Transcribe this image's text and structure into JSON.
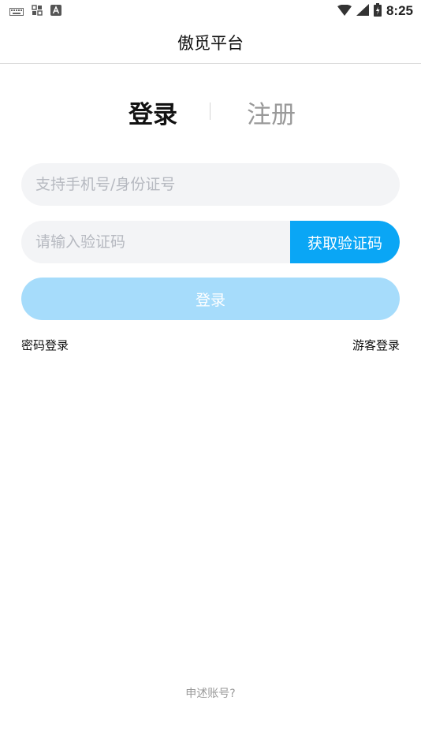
{
  "status_bar": {
    "time": "8:25",
    "icons": [
      "keyboard-icon",
      "grid-icon",
      "text-a-icon",
      "wifi-icon",
      "signal-icon",
      "battery-icon"
    ]
  },
  "header": {
    "title": "傲觅平台"
  },
  "tabs": {
    "login": "登录",
    "register": "注册"
  },
  "form": {
    "phone_placeholder": "支持手机号/身份证号",
    "code_placeholder": "请输入验证码",
    "get_code_label": "获取验证码",
    "login_label": "登录"
  },
  "links": {
    "password_login": "密码登录",
    "guest_login": "游客登录"
  },
  "footer": {
    "appeal": "申述账号?"
  },
  "colors": {
    "accent": "#0aa6f5",
    "login_disabled": "#a6dcfb",
    "input_bg": "#f3f4f6",
    "placeholder": "#b6b9c0"
  }
}
